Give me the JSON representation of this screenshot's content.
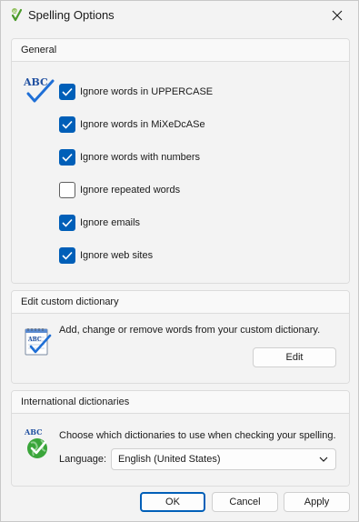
{
  "window": {
    "title": "Spelling Options"
  },
  "general": {
    "header": "General",
    "options": [
      {
        "label": "Ignore words in UPPERCASE",
        "checked": true
      },
      {
        "label": "Ignore words in MiXeDcASe",
        "checked": true
      },
      {
        "label": "Ignore words with numbers",
        "checked": true
      },
      {
        "label": "Ignore repeated words",
        "checked": false
      },
      {
        "label": "Ignore emails",
        "checked": true
      },
      {
        "label": "Ignore web sites",
        "checked": true
      }
    ]
  },
  "custom_dictionary": {
    "header": "Edit custom dictionary",
    "description": "Add, change or remove words from your custom dictionary.",
    "edit_label": "Edit"
  },
  "international": {
    "header": "International dictionaries",
    "description": "Choose which dictionaries to use when checking your spelling.",
    "language_label": "Language:",
    "language_value": "English (United States)"
  },
  "footer": {
    "ok_label": "OK",
    "cancel_label": "Cancel",
    "apply_label": "Apply"
  },
  "icons": {
    "abc_text": "ABC"
  },
  "colors": {
    "accent": "#005fb8",
    "check_blue": "#1f6fd6",
    "globe_green": "#3aa53a"
  }
}
